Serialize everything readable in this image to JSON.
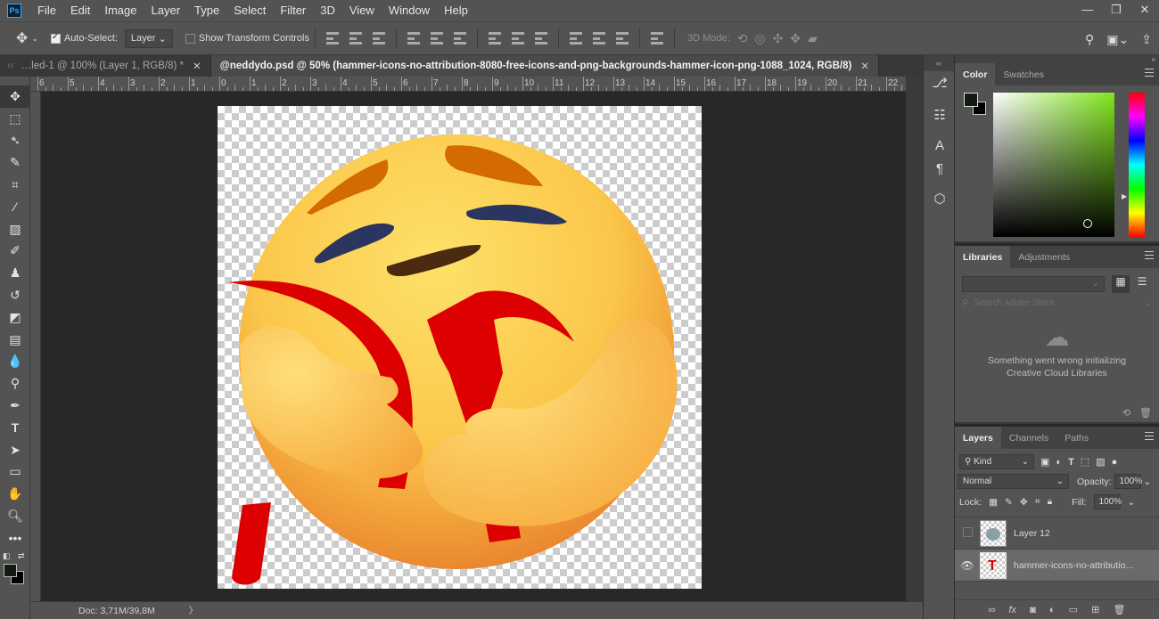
{
  "app": {
    "logo": "Ps"
  },
  "menu": [
    "File",
    "Edit",
    "Image",
    "Layer",
    "Type",
    "Select",
    "Filter",
    "3D",
    "View",
    "Window",
    "Help"
  ],
  "window_controls": {
    "minimize": "—",
    "restore": "❐",
    "close": "✕"
  },
  "options": {
    "auto_select_label": "Auto-Select:",
    "auto_select_value": "Layer",
    "show_transform_label": "Show Transform Controls",
    "mode_3d_label": "3D Mode:"
  },
  "tabs": [
    {
      "label": "…led-1 @ 100% (Layer 1, RGB/8) *",
      "close": "✕"
    },
    {
      "label": "@neddydo.psd @ 50% (hammer-icons-no-attribution-8080-free-icons-and-png-backgrounds-hammer-icon-png-1088_1024, RGB/8)",
      "close": "✕"
    }
  ],
  "ruler_labels": [
    "6",
    "5",
    "4",
    "3",
    "2",
    "1",
    "0",
    "1",
    "2",
    "3",
    "4",
    "5",
    "6",
    "7",
    "8",
    "9",
    "10",
    "11",
    "12",
    "13",
    "14",
    "15",
    "16",
    "17",
    "18",
    "19",
    "20",
    "21",
    "22"
  ],
  "status": {
    "doc": "Doc: 3,71M/39,8M",
    "arrow": "〉"
  },
  "color_panel": {
    "tabs": [
      "Color",
      "Swatches"
    ],
    "fg": "#121b12",
    "bg": "#000000"
  },
  "libraries_panel": {
    "tabs": [
      "Libraries",
      "Adjustments"
    ],
    "search_placeholder": "Search Adobe Stock",
    "error_line1": "Something went wrong initializing",
    "error_line2": "Creative Cloud Libraries"
  },
  "layers_panel": {
    "tabs": [
      "Layers",
      "Channels",
      "Paths"
    ],
    "filter_kind": "Kind",
    "blend_mode": "Normal",
    "opacity_label": "Opacity:",
    "opacity_value": "100%",
    "lock_label": "Lock:",
    "fill_label": "Fill:",
    "fill_value": "100%",
    "layers": [
      {
        "name": "Layer 12",
        "visible": false
      },
      {
        "name": "hammer-icons-no-attributio...",
        "visible": true
      }
    ],
    "footer_fx": "fx"
  },
  "icons": {
    "move": "move-icon",
    "marquee": "marquee-icon",
    "lasso": "lasso-icon"
  }
}
